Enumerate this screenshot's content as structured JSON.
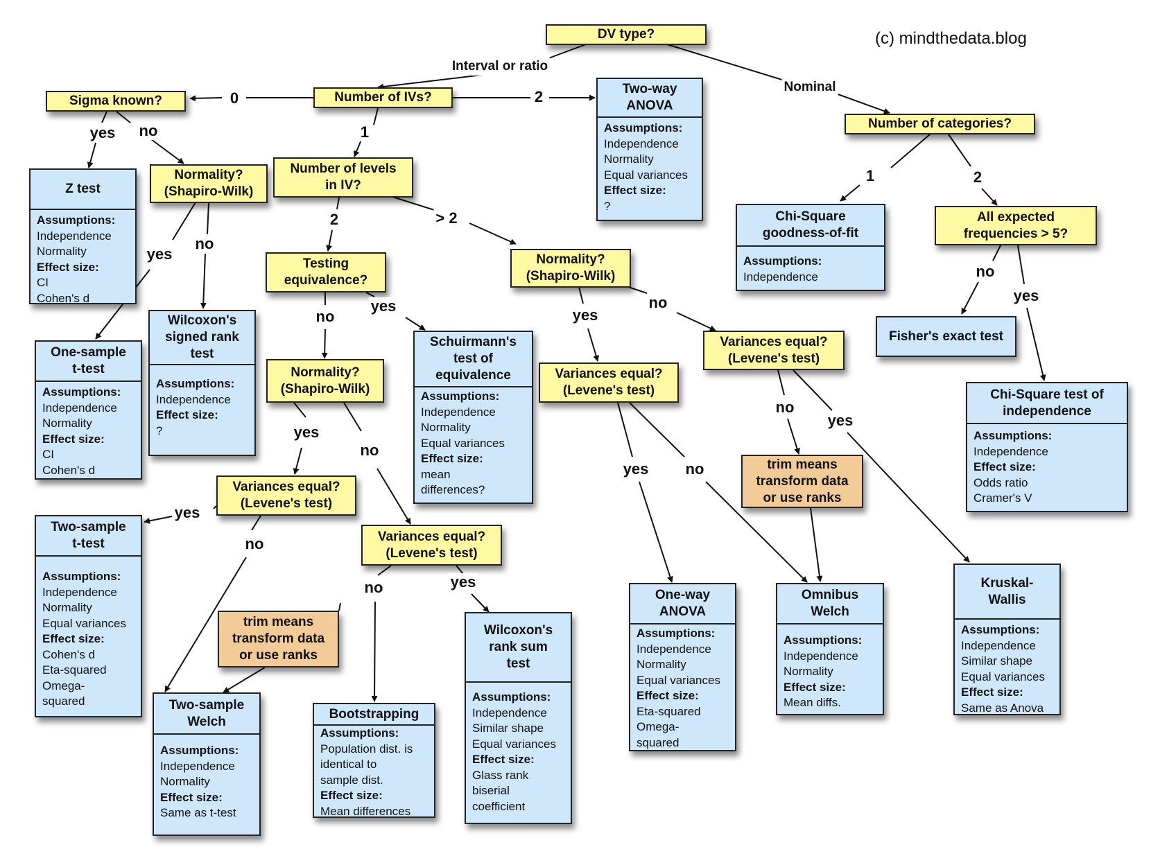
{
  "credit": "(c) mindthedata.blog",
  "colors": {
    "question": "#fff9a3",
    "test": "#cfe7fb",
    "action": "#f3cb98",
    "line": "#111111"
  },
  "questions": {
    "dv_type": "DV type?",
    "num_ivs": "Number of IVs?",
    "sigma_known": "Sigma known?",
    "num_categories": "Number of categories?",
    "normality_1": "Normality?\n(Shapiro-Wilk)",
    "num_levels": "Number of levels\nin IV?",
    "all_expected": "All expected\nfrequencies > 5?",
    "testing_equiv": "Testing\nequivalence?",
    "normality_2": "Normality?\n(Shapiro-Wilk)",
    "normality_3": "Normality?\n(Shapiro-Wilk)",
    "variances_a": "Variances equal?\n(Levene's test)",
    "variances_b": "Variances equal?\n(Levene's test)",
    "variances_c": "Variances equal?\n(Levene's test)",
    "variances_d": "Variances equal?\n(Levene's test)"
  },
  "actions": {
    "trim_right": "trim means\ntransform data\nor use ranks",
    "trim_left": "trim means\ntransform data\nor use ranks"
  },
  "tests": {
    "two_way_anova": {
      "title": "Two-way\nANOVA",
      "lines": [
        [
          "h",
          "Assumptions:"
        ],
        [
          "",
          "Independence"
        ],
        [
          "",
          "Normality"
        ],
        [
          "",
          "Equal variances"
        ],
        [
          "h",
          "Effect size:"
        ],
        [
          "",
          "?"
        ]
      ]
    },
    "z_test": {
      "title": "Z test",
      "lines": [
        [
          "h",
          "Assumptions:"
        ],
        [
          "",
          "Independence"
        ],
        [
          "",
          "Normality"
        ],
        [
          "h",
          "Effect size:"
        ],
        [
          "",
          "CI"
        ],
        [
          "",
          "Cohen's d"
        ]
      ]
    },
    "chi_gof": {
      "title": "Chi-Square\ngoodness-of-fit",
      "lines": [
        [
          "h",
          "Assumptions:"
        ],
        [
          "",
          "Independence"
        ]
      ]
    },
    "fisher": {
      "title": "Fisher's exact test",
      "lines": []
    },
    "wilcoxon_signed": {
      "title": "Wilcoxon's\nsigned rank\ntest",
      "lines": [
        [
          "h",
          "Assumptions:"
        ],
        [
          "",
          "Independence"
        ],
        [
          "h",
          "Effect size:"
        ],
        [
          "",
          "?"
        ]
      ]
    },
    "one_sample_t": {
      "title": "One-sample\nt-test",
      "lines": [
        [
          "h",
          "Assumptions:"
        ],
        [
          "",
          "Independence"
        ],
        [
          "",
          "Normality"
        ],
        [
          "h",
          "Effect size:"
        ],
        [
          "",
          "CI"
        ],
        [
          "",
          "Cohen's d"
        ]
      ]
    },
    "schuirmann": {
      "title": "Schuirmann's\ntest of\nequivalence",
      "lines": [
        [
          "h",
          "Assumptions:"
        ],
        [
          "",
          "Independence"
        ],
        [
          "",
          "Normality"
        ],
        [
          "",
          "Equal variances"
        ],
        [
          "h",
          "Effect size:"
        ],
        [
          "",
          "mean"
        ],
        [
          "",
          "differences?"
        ]
      ]
    },
    "chi_indep": {
      "title": "Chi-Square test of\nindependence",
      "lines": [
        [
          "h",
          "Assumptions:"
        ],
        [
          "",
          "Independence"
        ],
        [
          "h",
          "Effect size:"
        ],
        [
          "",
          "Odds ratio"
        ],
        [
          "",
          "Cramer's V"
        ]
      ]
    },
    "two_sample_t": {
      "title": "Two-sample\nt-test",
      "lines": [
        [
          "h",
          "Assumptions:"
        ],
        [
          "",
          "Independence"
        ],
        [
          "",
          "Normality"
        ],
        [
          "",
          "Equal variances"
        ],
        [
          "h",
          "Effect size:"
        ],
        [
          "",
          "Cohen's d"
        ],
        [
          "",
          "Eta-squared"
        ],
        [
          "",
          "Omega-"
        ],
        [
          "",
          "squared"
        ]
      ]
    },
    "one_way_anova": {
      "title": "One-way\nANOVA",
      "lines": [
        [
          "h",
          "Assumptions:"
        ],
        [
          "",
          "Independence"
        ],
        [
          "",
          "Normality"
        ],
        [
          "",
          "Equal variances"
        ],
        [
          "h",
          "Effect size:"
        ],
        [
          "",
          "Eta-squared"
        ],
        [
          "",
          "Omega-"
        ],
        [
          "",
          "squared"
        ]
      ]
    },
    "omnibus_welch": {
      "title": "Omnibus\nWelch",
      "lines": [
        [
          "h",
          "Assumptions:"
        ],
        [
          "",
          "Independence"
        ],
        [
          "",
          "Normality"
        ],
        [
          "h",
          "Effect size:"
        ],
        [
          "",
          "Mean diffs."
        ]
      ]
    },
    "kruskal": {
      "title": "Kruskal-\nWallis",
      "lines": [
        [
          "h",
          "Assumptions:"
        ],
        [
          "",
          "Independence"
        ],
        [
          "",
          "Similar shape"
        ],
        [
          "",
          "Equal variances"
        ],
        [
          "h",
          "Effect size:"
        ],
        [
          "",
          "Same as Anova"
        ]
      ]
    },
    "two_sample_welch": {
      "title": "Two-sample\nWelch",
      "lines": [
        [
          "h",
          "Assumptions:"
        ],
        [
          "",
          "Independence"
        ],
        [
          "",
          "Normality"
        ],
        [
          "h",
          "Effect size:"
        ],
        [
          "",
          "Same as t-test"
        ]
      ]
    },
    "bootstrapping": {
      "title": "Bootstrapping",
      "lines": [
        [
          "h",
          "Assumptions:"
        ],
        [
          "",
          "Population dist. is"
        ],
        [
          "",
          "identical to"
        ],
        [
          "",
          "sample dist."
        ],
        [
          "h",
          "Effect size:"
        ],
        [
          "",
          "Mean differences"
        ]
      ]
    },
    "wilcoxon_rank_sum": {
      "title": "Wilcoxon's\nrank sum\ntest",
      "lines": [
        [
          "h",
          "Assumptions:"
        ],
        [
          "",
          "Independence"
        ],
        [
          "",
          "Similar shape"
        ],
        [
          "",
          "Equal variances"
        ],
        [
          "h",
          "Effect size:"
        ],
        [
          "",
          "Glass rank"
        ],
        [
          "",
          "biserial"
        ],
        [
          "",
          "coefficient"
        ]
      ]
    }
  },
  "edge_labels": {
    "interval_or_ratio": "Interval or ratio",
    "nominal": "Nominal",
    "ivs_0": "0",
    "ivs_1": "1",
    "ivs_2": "2",
    "sigma_yes": "yes",
    "sigma_no": "no",
    "norm1_yes": "yes",
    "norm1_no": "no",
    "levels_2": "2",
    "levels_gt2": "> 2",
    "cat_1": "1",
    "cat_2": "2",
    "expected_no": "no",
    "expected_yes": "yes",
    "equiv_no": "no",
    "equiv_yes": "yes",
    "norm3_yes": "yes",
    "norm3_no": "no",
    "norm2_yes": "yes",
    "norm2_no": "no",
    "varb_yes": "yes",
    "varb_no": "no",
    "varc_no": "no",
    "varc_yes": "yes",
    "vara_yes": "yes",
    "vara_no": "no",
    "vard_no": "no",
    "vard_yes": "yes"
  }
}
